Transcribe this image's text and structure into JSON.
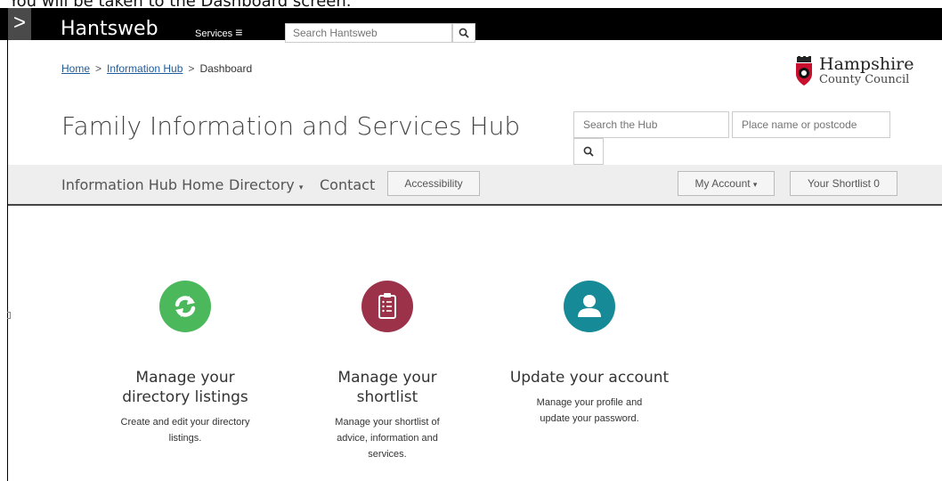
{
  "caption": "You will be taken to the Dashboard screen.",
  "topbar": {
    "toggle_glyph": ">",
    "brand": "Hantsweb",
    "services_label": "Services",
    "services_glyph": "≡",
    "search_placeholder": "Search Hantsweb",
    "search_icon": "search-icon"
  },
  "breadcrumb": {
    "items": [
      {
        "label": "Home",
        "link": true
      },
      {
        "label": "Information Hub",
        "link": true
      },
      {
        "label": "Dashboard",
        "link": false
      }
    ],
    "separator": ">"
  },
  "logo": {
    "line1": "Hampshire",
    "line2": "County Council"
  },
  "hub": {
    "title": "Family Information and Services Hub",
    "search_placeholder": "Search the Hub",
    "place_placeholder": "Place name or postcode"
  },
  "nav": {
    "home": "Information Hub Home",
    "directory": "Directory",
    "contact": "Contact",
    "accessibility": "Accessibility",
    "my_account": "My Account",
    "shortlist": "Your Shortlist 0",
    "caret_glyph": "▾"
  },
  "cards": [
    {
      "title_lines": [
        "Manage your",
        "directory listings"
      ],
      "desc_lines": [
        "Create and edit your directory",
        "listings."
      ],
      "color": "#4cb85c",
      "icon": "refresh-icon"
    },
    {
      "title_lines": [
        "Manage your",
        "shortlist"
      ],
      "desc_lines": [
        "Manage your shortlist of",
        "advice, information and",
        "services."
      ],
      "color": "#9b3249",
      "icon": "clipboard-icon"
    },
    {
      "title_lines": [
        "Update your account"
      ],
      "desc_lines": [
        "Manage your profile and",
        "update your password."
      ],
      "color": "#168a96",
      "icon": "user-icon"
    }
  ]
}
